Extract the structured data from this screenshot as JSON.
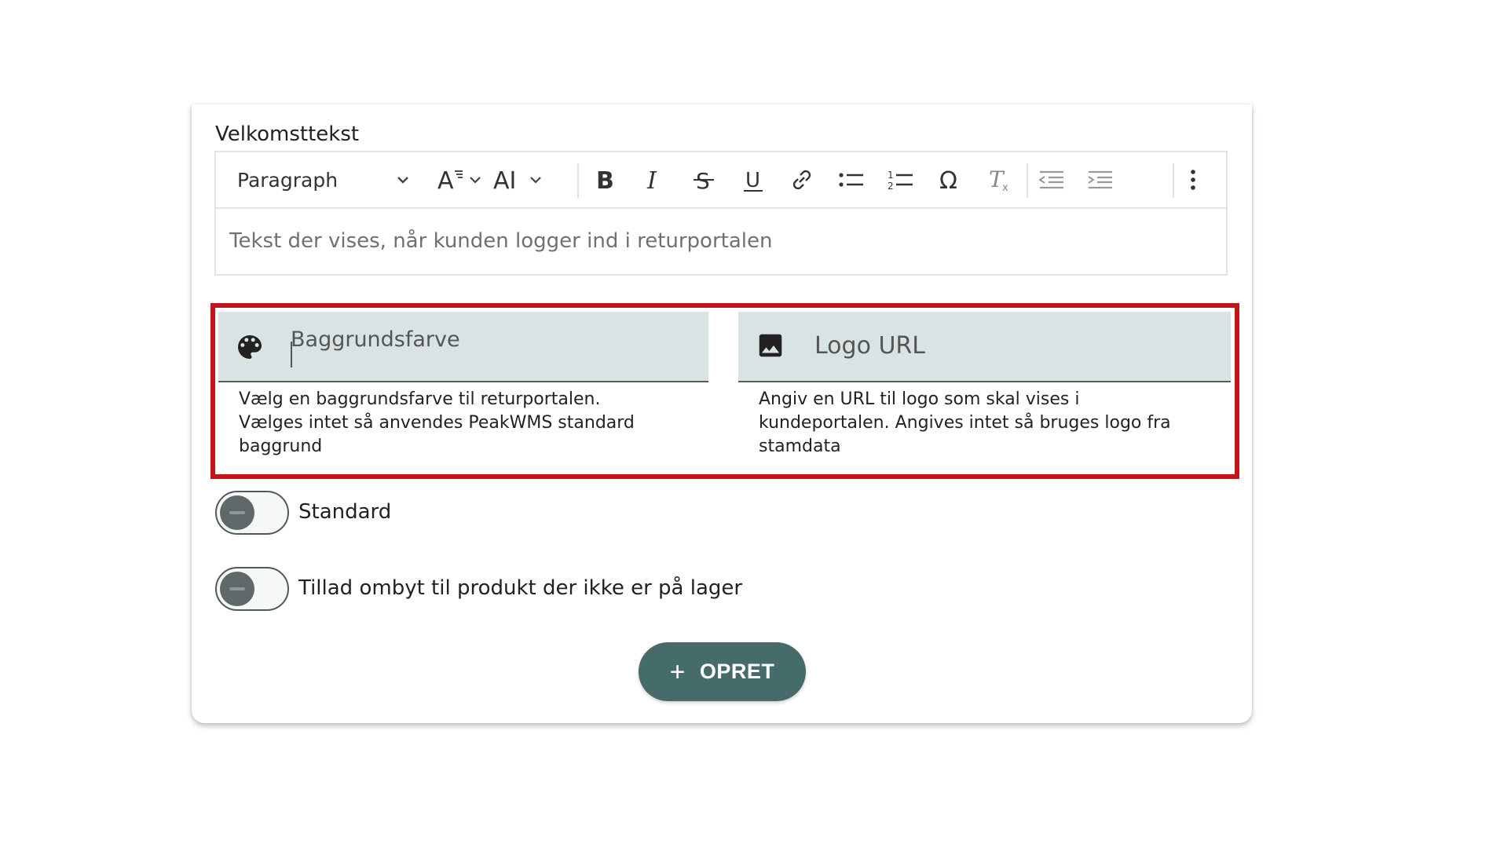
{
  "editor": {
    "label": "Velkomsttekst",
    "paragraph_select": "Paragraph",
    "placeholder": "Tekst der vises, når kunden logger ind i returportalen",
    "toolbar_icons": [
      "chevron-down-icon",
      "font-size-icon",
      "font-family-icon",
      "bold-icon",
      "italic-icon",
      "strikethrough-icon",
      "underline-icon",
      "link-icon",
      "bulleted-list-icon",
      "numbered-list-icon",
      "special-character-icon",
      "remove-format-icon",
      "outdent-icon",
      "indent-icon",
      "more-options-icon"
    ]
  },
  "fields": {
    "background_color": {
      "label": "Baggrundsfarve",
      "icon": "palette-icon",
      "hint": "Vælg en baggrundsfarve til returportalen.\nVælges intet så anvendes PeakWMS standard\nbaggrund"
    },
    "logo_url": {
      "label": "Logo URL",
      "icon": "image-icon",
      "hint": " Angiv en URL til logo som skal vises i\nkundeportalen. Angives intet så bruges logo fra\nstamdata"
    }
  },
  "toggles": [
    {
      "label": "Standard",
      "on": false
    },
    {
      "label": "Tillad ombyt til produkt der ikke er på lager",
      "on": false
    }
  ],
  "create_button": {
    "label": "OPRET",
    "icon": "plus-icon"
  },
  "colors": {
    "highlight": "#c1151b",
    "field_bg": "#d9e3e3",
    "button": "#466b6b"
  }
}
